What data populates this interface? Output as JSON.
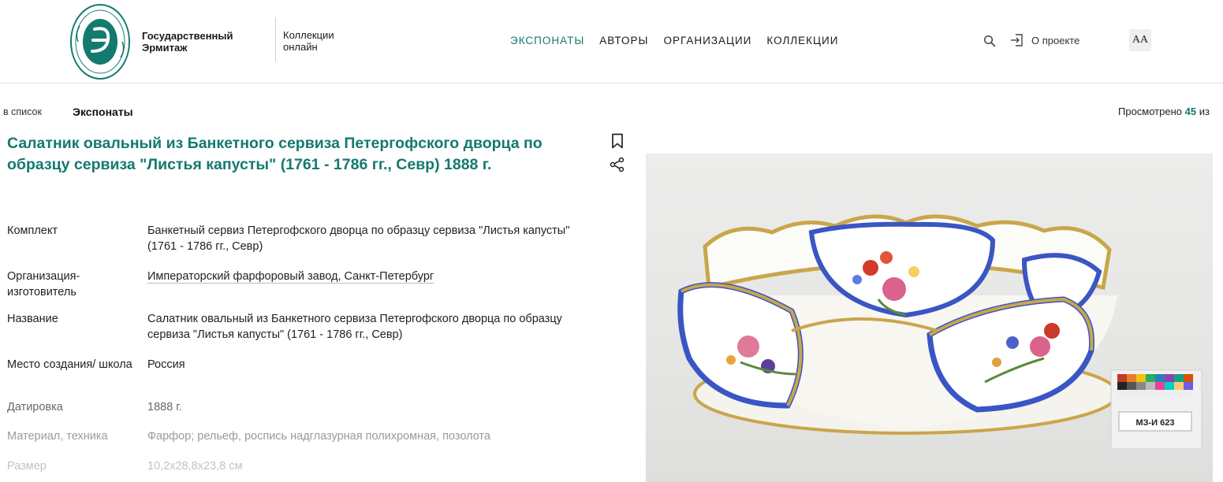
{
  "header": {
    "logo_alt": "Эрмитаж",
    "museum_name_line1": "Государственный",
    "museum_name_line2": "Эрмитаж",
    "section_line1": "Коллекции",
    "section_line2": "онлайн",
    "nav": [
      {
        "label": "ЭКСПОНАТЫ",
        "active": true
      },
      {
        "label": "АВТОРЫ",
        "active": false
      },
      {
        "label": "ОРГАНИЗАЦИИ",
        "active": false
      },
      {
        "label": "КОЛЛЕКЦИИ",
        "active": false
      }
    ],
    "about_label": "О проекте",
    "font_size_label": "AA",
    "accent_color": "#137a6e"
  },
  "breadcrumb": {
    "back_label": "в список",
    "current": "Экспонаты"
  },
  "viewed": {
    "prefix": "Просмотрено",
    "count": "45",
    "suffix": "из"
  },
  "item": {
    "title": "Салатник овальный из Банкетного сервиза Петергофского дворца по образцу сервиза \"Листья капусты\" (1761 - 1786 гг., Севр) 1888 г.",
    "fields": [
      {
        "label": "Комплект",
        "value": "Банкетный сервиз Петергофского дворца по образцу сервиза \"Листья капусты\" (1761 - 1786 гг., Севр)"
      },
      {
        "label": "Организация-изготовитель",
        "value": "Императорский фарфоровый завод, Санкт-Петербург"
      },
      {
        "label": "Название",
        "value": "Салатник овальный из Банкетного сервиза Петергофского дворца по образцу сервиза \"Листья капусты\" (1761 - 1786 гг., Севр)"
      },
      {
        "label": "Место создания/ школа",
        "value": "Россия"
      },
      {
        "label": "Датировка",
        "value": "1888 г."
      },
      {
        "label": "Материал, техника",
        "value": "Фарфор; рельеф, роспись надглазурная полихромная, позолота"
      },
      {
        "label": "Размер",
        "value": "10,2x28,8x23,8 см"
      }
    ]
  },
  "photo": {
    "inventory_tag": "МЗ-И 623"
  }
}
